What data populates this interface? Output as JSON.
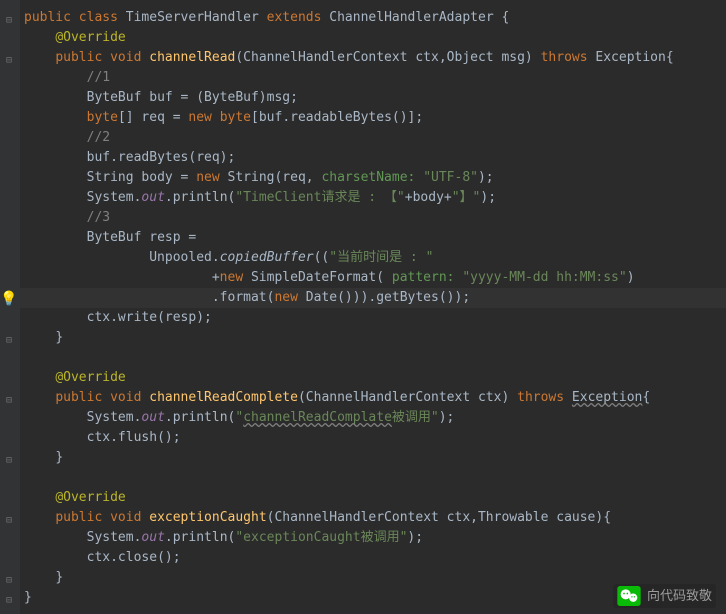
{
  "code": {
    "l1": {
      "a": "public",
      "b": "class",
      "c": "TimeServerHandler",
      "d": "extends",
      "e": "ChannelHandlerAdapter {"
    },
    "ann_override": "@Override",
    "l3": {
      "a": "public",
      "b": "void",
      "c": "channelRead",
      "d": "(ChannelHandlerContext ctx,Object msg)",
      "e": "throws",
      "f": "Exception{"
    },
    "c1": "//1",
    "l5": {
      "a": "ByteBuf buf = (ByteBuf)msg;"
    },
    "l6": {
      "a": "byte",
      "b": "[] req =",
      "c": "new",
      "d": "byte",
      "e": "[buf.readableBytes()];"
    },
    "c2": "//2",
    "l8": {
      "a": "buf.readBytes(req);"
    },
    "l9": {
      "a": "String body =",
      "b": "new",
      "c": "String(req,",
      "d": "charsetName:",
      "e": "\"UTF-8\"",
      "f": ");"
    },
    "l10": {
      "a": "System.",
      "b": "out",
      "c": ".println(",
      "d": "\"TimeClient请求是 : 【\"",
      "e": "+body+",
      "f": "\"】\"",
      "g": ");"
    },
    "c3": "//3",
    "l12": {
      "a": "ByteBuf resp ="
    },
    "l13": {
      "a": "Unpooled.",
      "b": "copiedBuffer",
      "c": "((",
      "d": "\"当前时间是 : \""
    },
    "l14": {
      "a": "+",
      "b": "new",
      "c": "SimpleDateFormat(",
      "d": "pattern:",
      "e": "\"yyyy-MM-dd hh:MM:ss\"",
      "f": ")"
    },
    "l15": {
      "a": ".format(",
      "b": "new",
      "c": "Date())).getBytes());"
    },
    "l16": {
      "a": "ctx.write(resp);"
    },
    "brace_close": "}",
    "l20": {
      "a": "public",
      "b": "void",
      "c": "channelReadComplete",
      "d": "(ChannelHandlerContext ctx)",
      "e": "throws",
      "f": "Exception",
      "g": "{"
    },
    "l21": {
      "a": "System.",
      "b": "out",
      "c": ".println(",
      "d": "\"",
      "e": "channelReadComplate",
      "f": "被调用\"",
      "g": ");"
    },
    "l22": {
      "a": "ctx.flush();"
    },
    "l26": {
      "a": "public",
      "b": "void",
      "c": "exceptionCaught",
      "d": "(ChannelHandlerContext ctx,Throwable cause){"
    },
    "l27": {
      "a": "System.",
      "b": "out",
      "c": ".println(",
      "d": "\"exceptionCaught被调用\"",
      "e": ");"
    },
    "l28": {
      "a": "ctx.close();"
    }
  },
  "footer": {
    "label": "向代码致敬"
  },
  "icons": {
    "bulb": "💡",
    "fold_open": "⊟",
    "fold_close": "⊟"
  }
}
